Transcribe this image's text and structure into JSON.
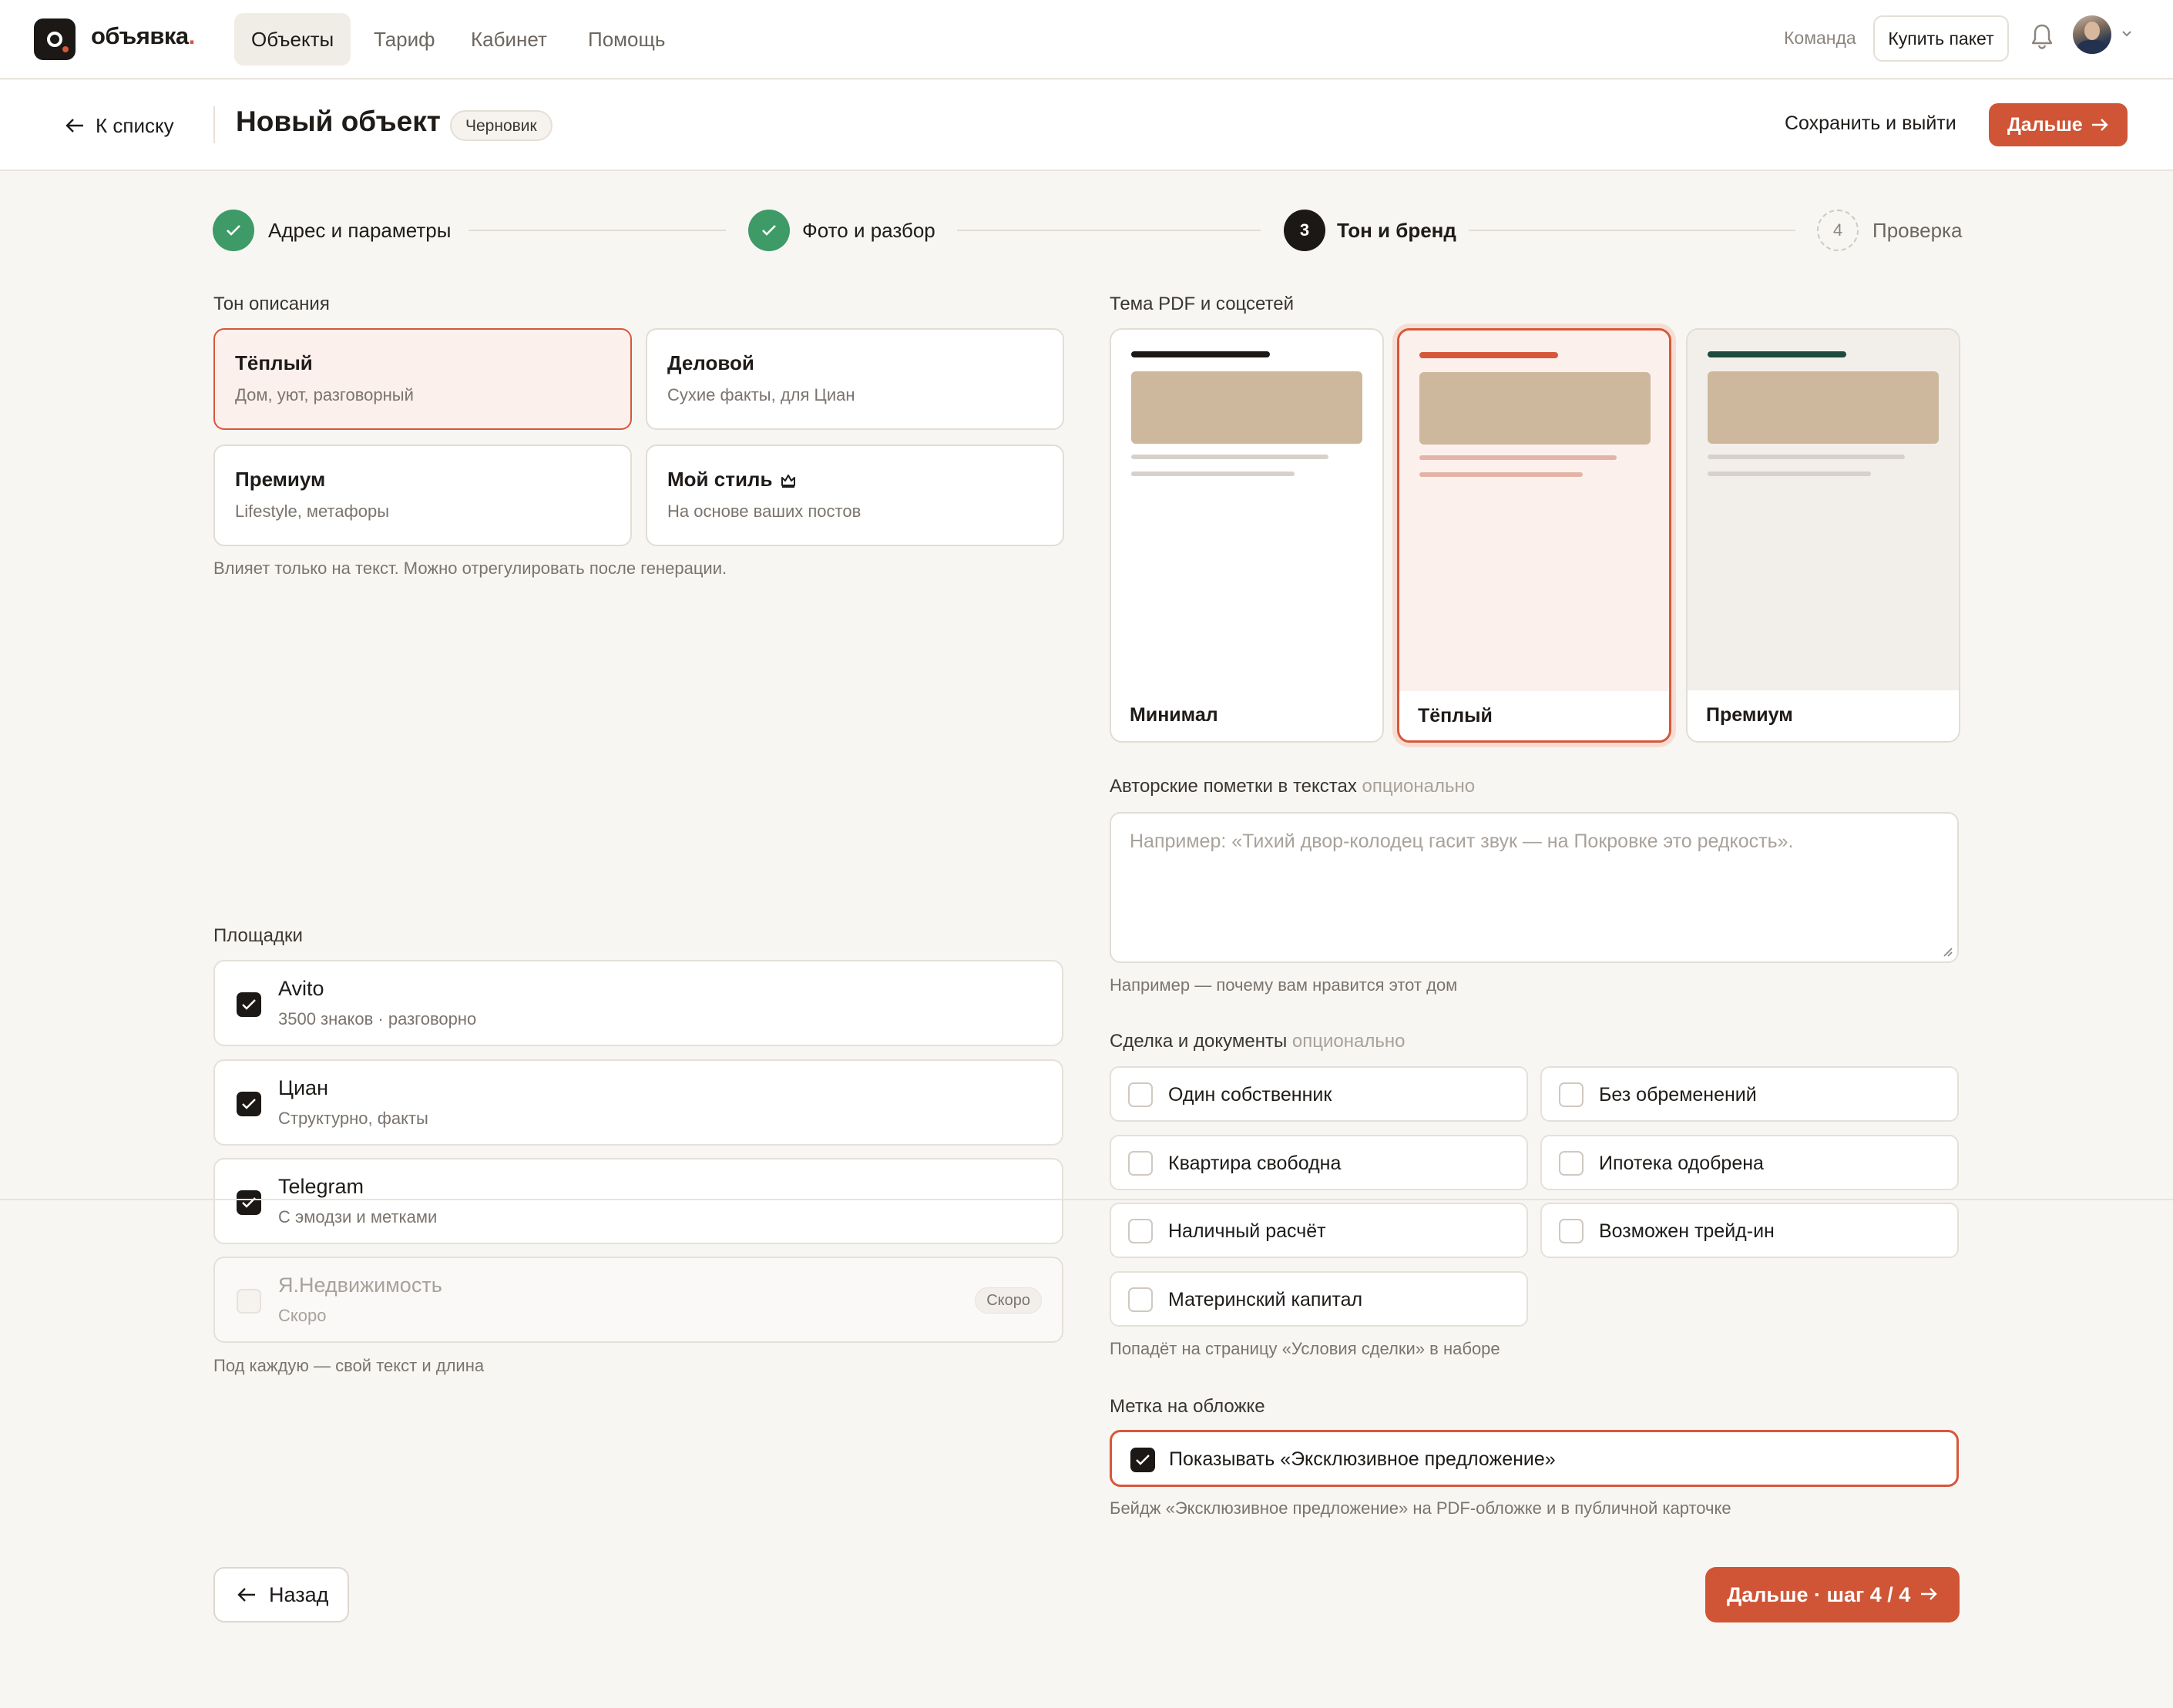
{
  "brand": {
    "name": "объявка",
    "dot": ".",
    "accent": "#d7573a"
  },
  "nav": {
    "items": [
      "Объекты",
      "Тариф",
      "Кабинет",
      "Помощь"
    ],
    "active": 0
  },
  "topbar": {
    "team": "Команда",
    "buy": "Купить пакет"
  },
  "subbar": {
    "back": "К списку",
    "title": "Новый объект",
    "status": "Черновик",
    "save_exit": "Сохранить и выйти",
    "next": "Дальше"
  },
  "steps": [
    {
      "label": "Адрес и параметры",
      "state": "done"
    },
    {
      "label": "Фото и разбор",
      "state": "done"
    },
    {
      "label": "Тон и бренд",
      "state": "current",
      "number": "3"
    },
    {
      "label": "Проверка",
      "state": "todo",
      "number": "4"
    }
  ],
  "tone": {
    "label": "Тон описания",
    "options": [
      {
        "title": "Тёплый",
        "subtitle": "Дом, уют, разговорный",
        "selected": true
      },
      {
        "title": "Деловой",
        "subtitle": "Сухие факты, для Циан",
        "selected": false
      },
      {
        "title": "Премиум",
        "subtitle": "Lifestyle, метафоры",
        "selected": false
      },
      {
        "title": "Мой стиль",
        "subtitle": "На основе ваших постов",
        "selected": false,
        "icon": "crown-icon"
      }
    ],
    "hint": "Влияет только на текст. Можно отрегулировать после генерации."
  },
  "theme": {
    "label": "Тема PDF и соцсетей",
    "options": [
      {
        "name": "Минимал",
        "bar_color": "#1b1816",
        "bg": "#ffffff",
        "selected": false
      },
      {
        "name": "Тёплый",
        "bar_color": "#d7573a",
        "bg": "#fcf0ec",
        "selected": true
      },
      {
        "name": "Премиум",
        "bar_color": "#1f4a3d",
        "bg": "#f2efea",
        "selected": false
      }
    ]
  },
  "notes": {
    "label": "Авторские пометки в текстах",
    "optional": "опционально",
    "placeholder": "Например: «Тихий двор-колодец гасит звук — на Покровке это редкость».",
    "hint": "Например — почему вам нравится этот дом"
  },
  "platforms": {
    "label": "Площадки",
    "items": [
      {
        "name": "Avito",
        "desc": "3500 знаков · разговорно",
        "checked": true
      },
      {
        "name": "Циан",
        "desc": "Структурно, факты",
        "checked": true
      },
      {
        "name": "Telegram",
        "desc": "С эмодзи и метками",
        "checked": true
      },
      {
        "name": "Я.Недвижимость",
        "desc": "Скоро",
        "checked": false,
        "disabled": true,
        "badge": "Скоро"
      }
    ],
    "hint": "Под каждую — свой текст и длина"
  },
  "deal": {
    "label": "Сделка и документы",
    "optional": "опционально",
    "items": [
      "Один собственник",
      "Без обременений",
      "Квартира свободна",
      "Ипотека одобрена",
      "Наличный расчёт",
      "Возможен трейд-ин",
      "Материнский капитал"
    ],
    "hint": "Попадёт на страницу «Условия сделки» в наборе"
  },
  "cover": {
    "label": "Метка на обложке",
    "checkbox": "Показывать «Эксклюзивное предложение»",
    "checked": true,
    "hint": "Бейдж «Эксклюзивное предложение» на PDF-обложке и в публичной карточке"
  },
  "footer": {
    "back": "Назад",
    "next": "Дальше · шаг 4 / 4"
  }
}
